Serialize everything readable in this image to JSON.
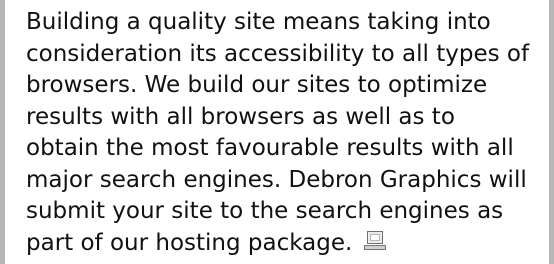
{
  "article": {
    "lines": [
      "Building a quality site means taking into",
      "consideration its accessibility to all types of",
      "browsers. We build our sites to optimize",
      "results with all browsers as well as to",
      "obtain the most favourable results with all",
      "major search engines. Debron Graphics will",
      "submit your site to the search engines as",
      "part of our hosting package."
    ],
    "end_icon": "computer-icon"
  },
  "colors": {
    "border": "#b7b7b7",
    "text": "#111111",
    "background": "#ffffff"
  }
}
